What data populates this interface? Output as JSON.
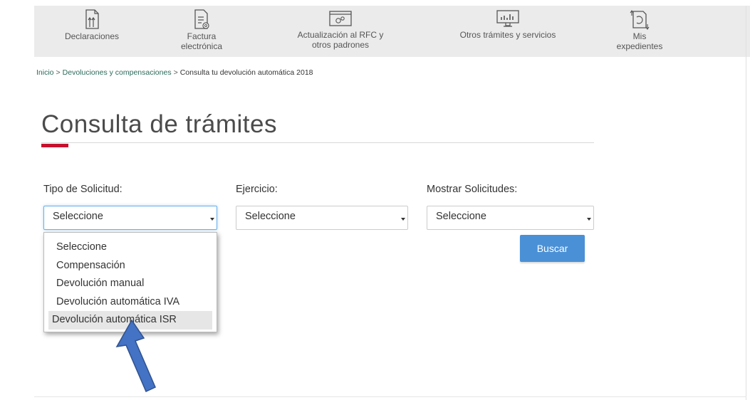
{
  "nav": {
    "items": [
      {
        "label": "Declaraciones",
        "icon": "document-arrows-icon"
      },
      {
        "label": "Factura\nelectrónica",
        "icon": "invoice-at-icon"
      },
      {
        "label": "Actualización al RFC y\notros padrones",
        "icon": "browser-gears-icon"
      },
      {
        "label": "Otros trámites y servicios",
        "icon": "monitor-chart-icon"
      },
      {
        "label": "Mis\nexpedientes",
        "icon": "folder-refresh-icon"
      }
    ]
  },
  "breadcrumb": {
    "home": "Inicio",
    "section": "Devoluciones y compensaciones",
    "current": "Consulta tu devolución automática 2018",
    "separator": ">"
  },
  "page": {
    "title": "Consulta de trámites",
    "accent_color": "#c8102e"
  },
  "form": {
    "tipo_label": "Tipo de Solicitud:",
    "tipo_value": "Seleccione",
    "ejercicio_label": "Ejercicio:",
    "ejercicio_value": "Seleccione",
    "mostrar_label": "Mostrar Solicitudes:",
    "mostrar_value": "Seleccione",
    "search_button": "Buscar",
    "button_color": "#4a90d6"
  },
  "dropdown": {
    "options": [
      "Seleccione",
      "Compensación",
      "Devolución manual",
      "Devolución automática IVA",
      "Devolución automática ISR"
    ],
    "highlighted": "Devolución automática ISR"
  },
  "annotation": {
    "arrow_color": "#4472c4"
  }
}
